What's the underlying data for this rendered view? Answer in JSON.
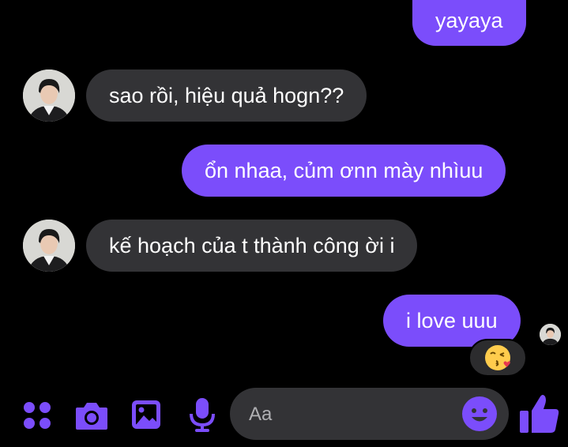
{
  "conversation": {
    "messages": [
      {
        "sender": "me",
        "text": "yayaya"
      },
      {
        "sender": "other",
        "text": "sao rồi, hiệu quả hogn??"
      },
      {
        "sender": "me",
        "text": "ổn nhaa, củm ơnn mày nhìuu"
      },
      {
        "sender": "other",
        "text": "kế hoạch của t thành công ời i"
      },
      {
        "sender": "me",
        "text": "i love uuu",
        "reaction": "kissing-face-emoji"
      }
    ]
  },
  "composer": {
    "placeholder": "Aa",
    "tools": [
      "apps-menu-icon",
      "camera-icon",
      "gallery-icon",
      "microphone-icon"
    ],
    "emoji_icon": "smiley-icon",
    "send_icon": "thumbs-up-icon"
  },
  "colors": {
    "background": "#000000",
    "outgoing_bubble": "#7b4dfb",
    "incoming_bubble": "#333336",
    "accent": "#7b4dfb"
  }
}
